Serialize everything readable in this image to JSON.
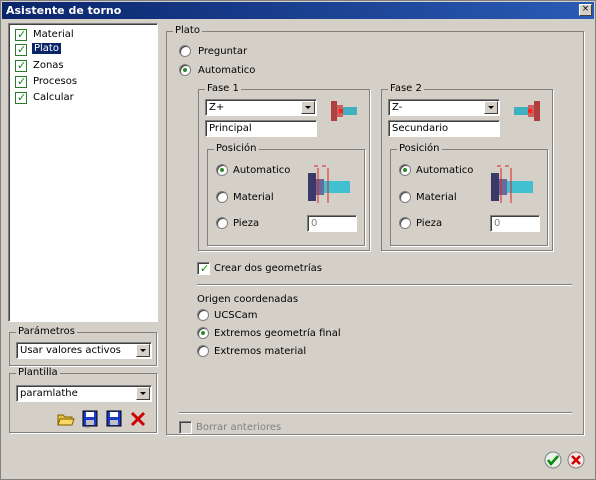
{
  "window": {
    "title": "Asistente de torno",
    "close_glyph": "×"
  },
  "sidebar": {
    "items": [
      {
        "label": "Material",
        "checked": true,
        "selected": false
      },
      {
        "label": "Plato",
        "checked": true,
        "selected": true
      },
      {
        "label": "Zonas",
        "checked": true,
        "selected": false
      },
      {
        "label": "Procesos",
        "checked": true,
        "selected": false
      },
      {
        "label": "Calcular",
        "checked": true,
        "selected": false
      }
    ]
  },
  "parametros": {
    "label": "Parámetros",
    "value": "Usar valores activos"
  },
  "plantilla": {
    "label": "Plantilla",
    "value": "paramlathe"
  },
  "plato": {
    "label": "Plato",
    "options": [
      "Preguntar",
      "Automatico"
    ],
    "selected": "Automatico"
  },
  "fase1": {
    "label": "Fase 1",
    "direction": "Z+",
    "name": "Principal",
    "posicion_label": "Posición",
    "options": [
      "Automatico",
      "Material",
      "Pieza"
    ],
    "selected": "Automatico",
    "pieza_value": "0"
  },
  "fase2": {
    "label": "Fase 2",
    "direction": "Z-",
    "name": "Secundario",
    "posicion_label": "Posición",
    "options": [
      "Automatico",
      "Material",
      "Pieza"
    ],
    "selected": "Automatico",
    "pieza_value": "0"
  },
  "crear_dos": {
    "label": "Crear dos geometrías",
    "checked": true
  },
  "origen": {
    "label": "Origen coordenadas",
    "options": [
      "UCSCam",
      "Extremos geometría final",
      "Extremos material"
    ],
    "selected": "Extremos geometría final"
  },
  "borrar": {
    "label": "Borrar anteriores",
    "checked": false,
    "enabled": false
  },
  "colors": {
    "title_bg": "#0a246a",
    "check": "#0a8a0a",
    "radio_dot": "#2a8a2a",
    "delete": "#d00000"
  }
}
